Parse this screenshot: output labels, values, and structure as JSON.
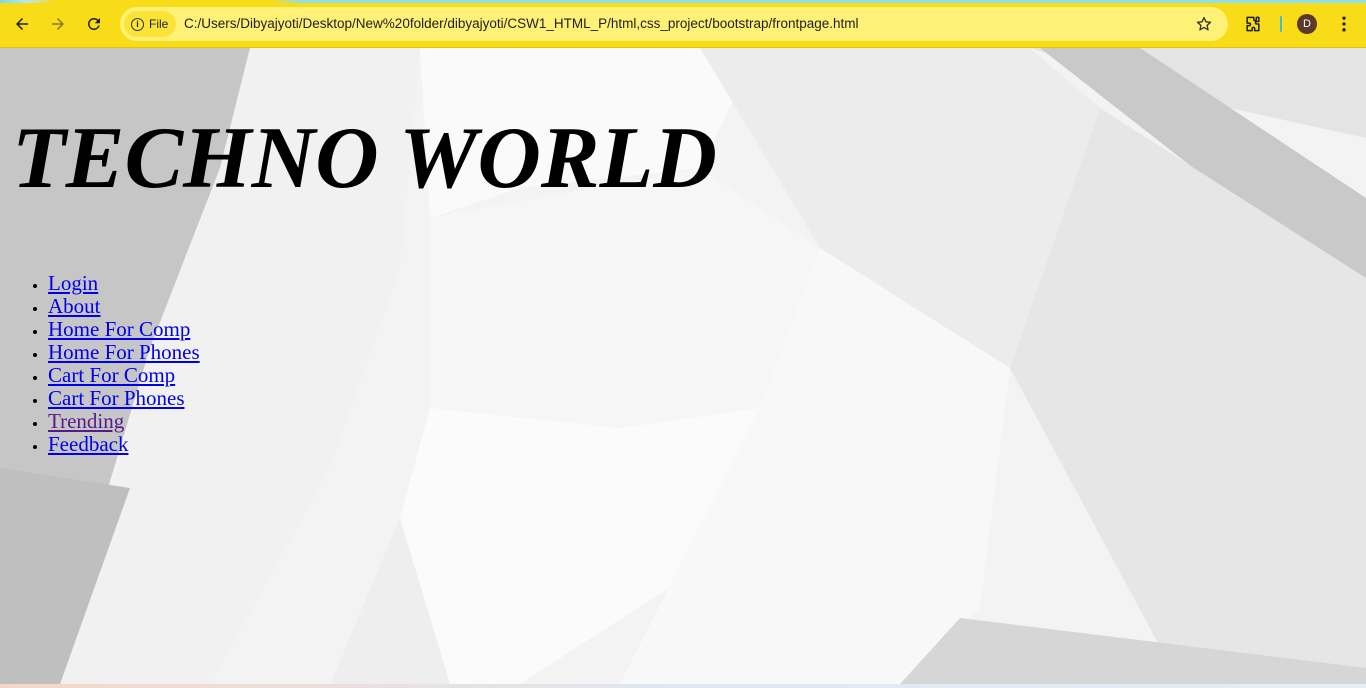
{
  "browser": {
    "site_chip_label": "File",
    "url": "C:/Users/Dibyajyoti/Desktop/New%20folder/dibyajyoti/CSW1_HTML_P/html,css_project/bootstrap/frontpage.html",
    "profile_initial": "D",
    "icons": [
      "back-arrow-icon",
      "forward-arrow-icon",
      "reload-icon",
      "info-icon",
      "star-icon",
      "extensions-icon",
      "kebab-menu-icon"
    ],
    "colors": {
      "toolbar": "#f9dc18",
      "omnibox": "#fff176",
      "avatar": "#5b3a2a"
    }
  },
  "page": {
    "title": "TECHNO WORLD",
    "nav_links": [
      {
        "label": "Login",
        "visited": false
      },
      {
        "label": "About",
        "visited": false
      },
      {
        "label": "Home For Comp",
        "visited": false
      },
      {
        "label": "Home For Phones",
        "visited": false
      },
      {
        "label": "Cart For Comp",
        "visited": false
      },
      {
        "label": "Cart For Phones",
        "visited": false
      },
      {
        "label": "Trending",
        "visited": true
      },
      {
        "label": "Feedback",
        "visited": false
      }
    ],
    "colors": {
      "link": "#0000ee",
      "visited_link": "#551a8b",
      "title": "#000000"
    }
  }
}
